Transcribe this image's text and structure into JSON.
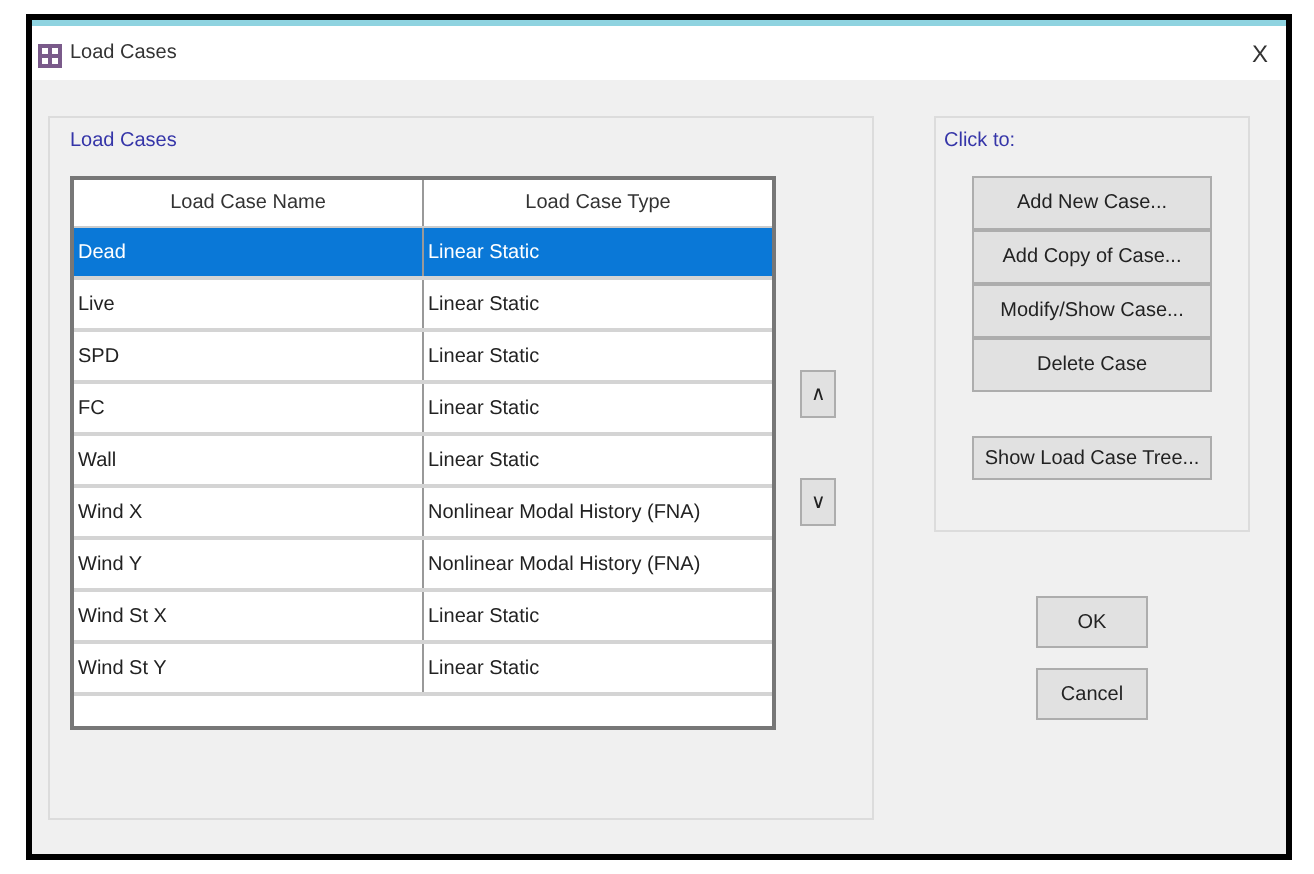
{
  "window": {
    "title": "Load Cases",
    "close": "X"
  },
  "load_cases_group": {
    "title": "Load Cases"
  },
  "table": {
    "columns": [
      "Load Case Name",
      "Load Case Type"
    ],
    "rows": [
      {
        "name": "Dead",
        "type": "Linear Static",
        "selected": true
      },
      {
        "name": "Live",
        "type": "Linear Static",
        "selected": false
      },
      {
        "name": "SPD",
        "type": "Linear Static",
        "selected": false
      },
      {
        "name": "FC",
        "type": "Linear Static",
        "selected": false
      },
      {
        "name": "Wall",
        "type": "Linear Static",
        "selected": false
      },
      {
        "name": "Wind X",
        "type": "Nonlinear Modal History (FNA)",
        "selected": false
      },
      {
        "name": "Wind Y",
        "type": "Nonlinear Modal History (FNA)",
        "selected": false
      },
      {
        "name": "Wind St X",
        "type": "Linear Static",
        "selected": false
      },
      {
        "name": "Wind St Y",
        "type": "Linear Static",
        "selected": false
      }
    ]
  },
  "move_buttons": [
    "∧",
    "∨"
  ],
  "click_to": {
    "title": "Click to:",
    "buttons": [
      "Add New Case...",
      "Add Copy of Case...",
      "Modify/Show Case...",
      "Delete Case"
    ],
    "tree_button": "Show Load Case Tree..."
  },
  "dialog_buttons": [
    "OK",
    "Cancel"
  ]
}
